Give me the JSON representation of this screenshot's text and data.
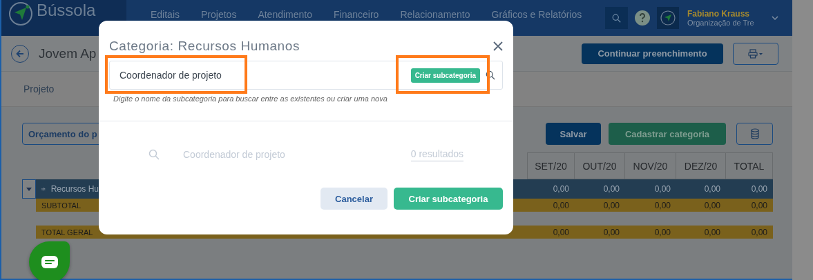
{
  "nav": {
    "brand": "Bússola",
    "items": [
      "Editais",
      "Projetos",
      "Atendimento",
      "Financeiro",
      "Relacionamento",
      "Gráficos e Relatórios"
    ],
    "user_name": "Fabiano Krauss",
    "user_org": "Organização de Tre"
  },
  "page": {
    "title": "Jovem Ap",
    "primary_action": "Continuar preenchimento",
    "section_tab": "Projeto"
  },
  "toolbar": {
    "budget_button": "Orçamento do p",
    "save": "Salvar",
    "add_category": "Cadastrar categoria"
  },
  "table": {
    "columns": [
      "SET/20",
      "OUT/20",
      "NOV/20",
      "DEZ/20",
      "TOTAL"
    ],
    "rows": [
      {
        "kind": "category",
        "label": "Recursos Hu",
        "expanded": true,
        "values": [
          "0,00",
          "0,00",
          "0,00",
          "0,00",
          "0,00"
        ]
      },
      {
        "kind": "subtotal",
        "label": "SUBTOTAL",
        "values": [
          "0,00",
          "0,00",
          "0,00",
          "0,00",
          "0,00"
        ]
      },
      {
        "kind": "total",
        "label": "TOTAL GERAL",
        "values": [
          "0,00",
          "0,00",
          "0,00",
          "0,00",
          "0,00"
        ]
      }
    ]
  },
  "modal": {
    "title": "Categoria: Recursos Humanos",
    "search": {
      "value": "Coordenador de projeto",
      "highlighted": true,
      "inline_action": "Criar subcategoria",
      "inline_action_highlighted": true
    },
    "hint": "Digite o nome da subcategoria para buscar entre as existentes ou criar uma nova",
    "result": {
      "query": "Coordenador de projeto",
      "count": "0 resultados"
    },
    "buttons": [
      {
        "label": "Cancelar",
        "kind": "secondary"
      },
      {
        "label": "Criar subcategoria",
        "kind": "primary"
      }
    ]
  }
}
